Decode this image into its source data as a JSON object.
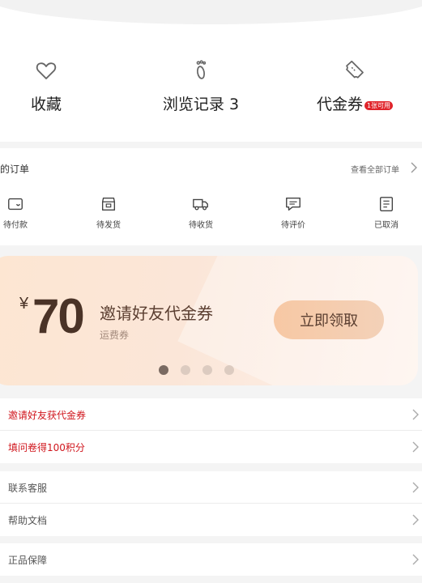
{
  "quick_links": [
    {
      "label": "收藏",
      "icon": "heart-icon"
    },
    {
      "label": "浏览记录 3",
      "icon": "footprint-icon"
    },
    {
      "label": "代金券",
      "icon": "ticket-icon",
      "badge": "1张可用"
    }
  ],
  "orders": {
    "title": "的订单",
    "view_all": "查看全部订单",
    "items": [
      {
        "label": "待付款",
        "icon": "wallet-icon"
      },
      {
        "label": "待发货",
        "icon": "box-icon"
      },
      {
        "label": "待收货",
        "icon": "truck-icon"
      },
      {
        "label": "待评价",
        "icon": "comment-icon"
      },
      {
        "label": "已取消",
        "icon": "cancel-document-icon"
      }
    ]
  },
  "banner": {
    "currency": "¥",
    "amount": "70",
    "title": "邀请好友代金券",
    "subtitle": "运费券",
    "button": "立即领取",
    "page_count": 4,
    "active_page": 1
  },
  "menus": {
    "promo": [
      {
        "label": "邀请好友获代金券",
        "highlight": true
      },
      {
        "label": "填问卷得100积分",
        "highlight": true
      }
    ],
    "support": [
      {
        "label": "联系客服"
      },
      {
        "label": "帮助文档"
      }
    ],
    "guarantee": [
      {
        "label": "正品保障"
      }
    ]
  },
  "colors": {
    "accent_red": "#d0161d",
    "badge_red": "#e0242b",
    "banner_text": "#4a3327",
    "banner_button": "#f7c8a4"
  }
}
